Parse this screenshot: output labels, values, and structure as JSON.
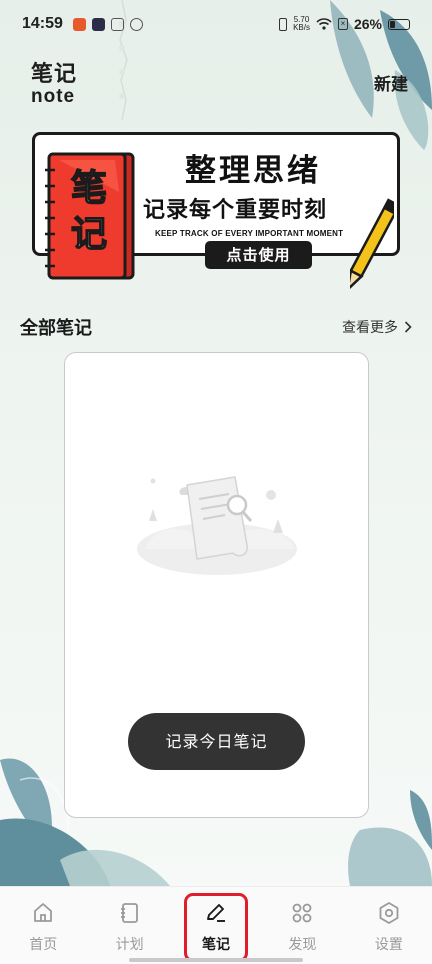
{
  "status_bar": {
    "time": "14:59",
    "net_speed_value": "5.70",
    "net_speed_unit": "KB/s",
    "battery": "26%"
  },
  "header": {
    "title_cn": "笔记",
    "title_en": "note",
    "new_button": "新建"
  },
  "banner": {
    "headline": "整理思绪",
    "subheadline": "记录每个重要时刻",
    "tagline_en": "KEEP TRACK OF EVERY IMPORTANT MOMENT",
    "cta": "点击使用",
    "notebook_text": "笔记"
  },
  "section": {
    "title": "全部笔记",
    "see_more": "查看更多"
  },
  "notes_card": {
    "record_button": "记录今日笔记"
  },
  "bottom_nav": {
    "items": [
      {
        "label": "首页",
        "icon": "home-icon"
      },
      {
        "label": "计划",
        "icon": "notebook-icon"
      },
      {
        "label": "笔记",
        "icon": "pen-icon"
      },
      {
        "label": "发现",
        "icon": "grid-icon"
      },
      {
        "label": "设置",
        "icon": "hexagon-settings-icon"
      }
    ],
    "active_index": 2
  },
  "colors": {
    "accent_red": "#e11d2b",
    "button_dark": "#333333",
    "notebook_red": "#ef3b2d",
    "leaf_teal": "#7fa8b4",
    "pencil_yellow": "#f3c21b"
  }
}
